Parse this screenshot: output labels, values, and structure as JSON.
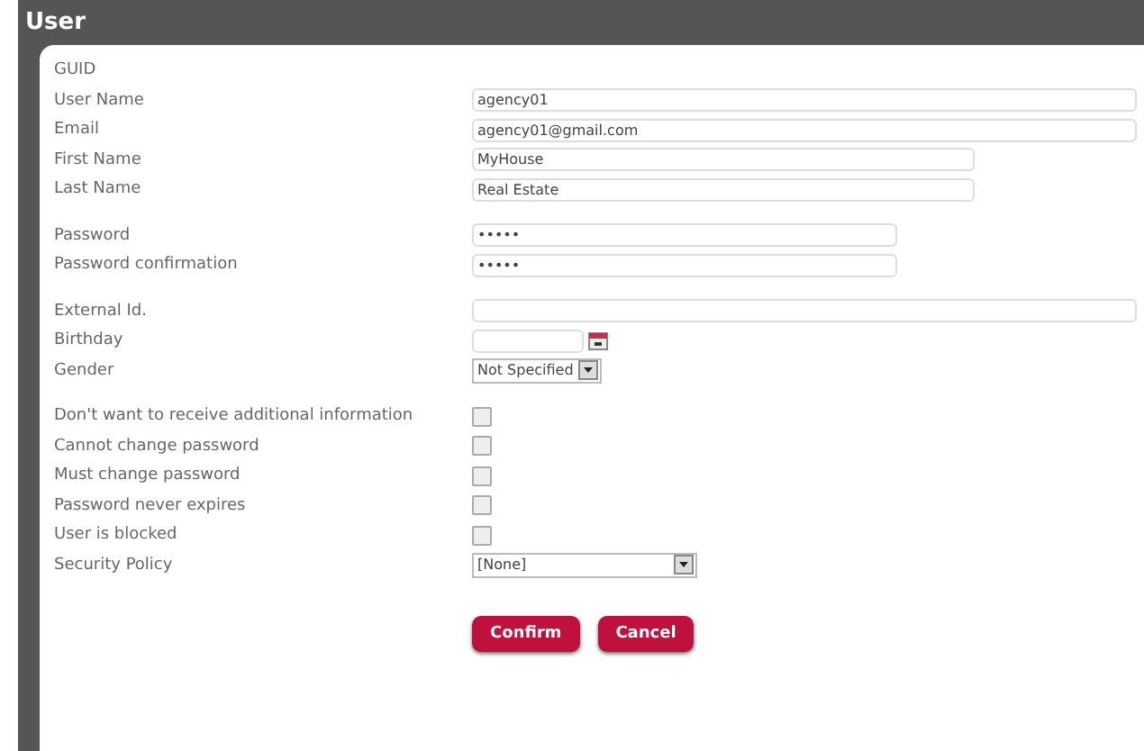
{
  "window": {
    "title": "User"
  },
  "groups": [
    [
      {
        "kind": "label",
        "label": "GUID"
      },
      {
        "kind": "text",
        "label": "User Name",
        "value": "agency01"
      },
      {
        "kind": "text",
        "label": "Email",
        "value": "agency01@gmail.com"
      },
      {
        "kind": "text",
        "label": "First Name",
        "value": "MyHouse"
      },
      {
        "kind": "text",
        "label": "Last Name",
        "value": "Real Estate"
      }
    ],
    [
      {
        "kind": "password",
        "label": "Password",
        "value": "•••••"
      },
      {
        "kind": "password",
        "label": "Password confirmation",
        "value": "•••••"
      }
    ],
    [
      {
        "kind": "text",
        "label": "External Id."
      },
      {
        "kind": "date",
        "label": "Birthday"
      },
      {
        "kind": "select",
        "label": "Gender",
        "value": "Not Specified"
      }
    ],
    [
      {
        "kind": "checkbox",
        "label": "Don't want to receive additional information",
        "checked": false
      },
      {
        "kind": "checkbox",
        "label": "Cannot change password",
        "checked": false
      },
      {
        "kind": "checkbox",
        "label": "Must change password",
        "checked": false
      },
      {
        "kind": "checkbox",
        "label": "Password never expires",
        "checked": false
      },
      {
        "kind": "checkbox",
        "label": "User is blocked",
        "checked": false
      },
      {
        "kind": "select",
        "label": "Security Policy",
        "value": "[None]"
      }
    ]
  ],
  "buttons": [
    "Confirm",
    "Cancel"
  ]
}
